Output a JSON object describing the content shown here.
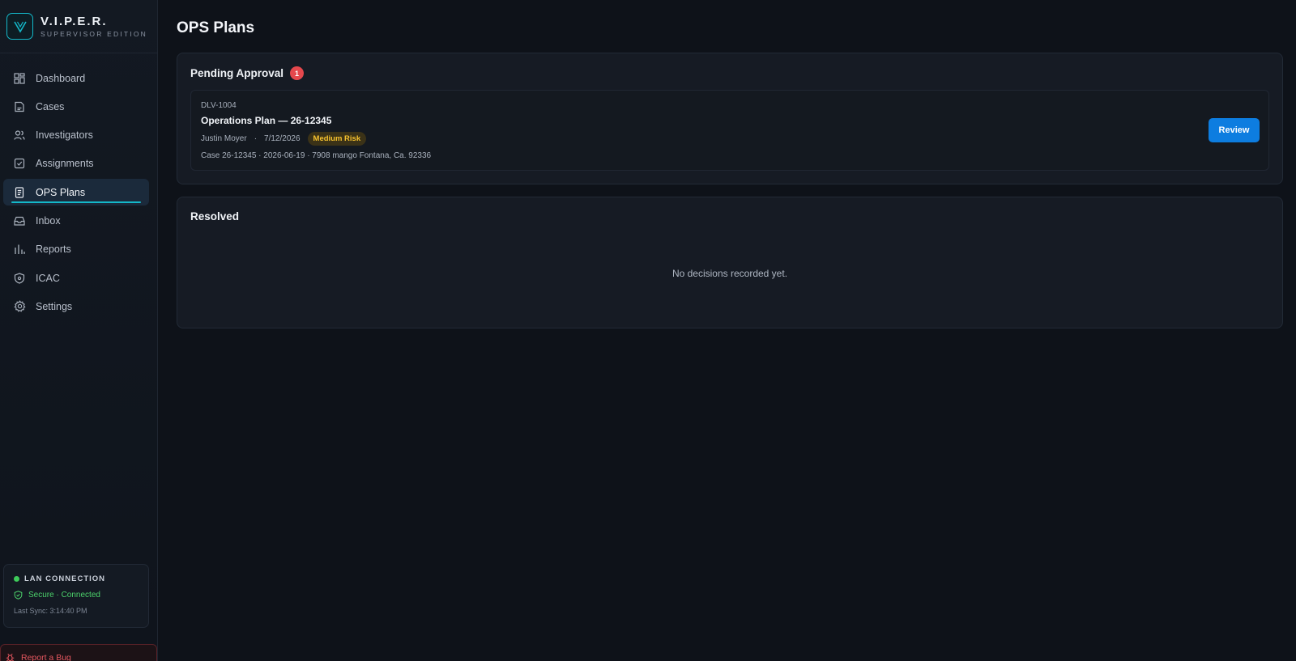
{
  "brand": {
    "title": "V.I.P.E.R.",
    "subtitle": "SUPERVISOR EDITION"
  },
  "sidebar": {
    "items": [
      {
        "label": "Dashboard",
        "icon": "dashboard-icon"
      },
      {
        "label": "Cases",
        "icon": "folder-icon"
      },
      {
        "label": "Investigators",
        "icon": "users-icon"
      },
      {
        "label": "Assignments",
        "icon": "checkbox-icon"
      },
      {
        "label": "OPS Plans",
        "icon": "document-icon",
        "active": true
      },
      {
        "label": "Inbox",
        "icon": "inbox-icon"
      },
      {
        "label": "Reports",
        "icon": "bar-chart-icon"
      },
      {
        "label": "ICAC",
        "icon": "shield-icon"
      },
      {
        "label": "Settings",
        "icon": "gear-icon"
      }
    ]
  },
  "lan": {
    "heading": "LAN CONNECTION",
    "status": "Secure · Connected",
    "last_sync": "Last Sync: 3:14:40 PM"
  },
  "bug_report": {
    "label": "Report a Bug"
  },
  "main": {
    "title": "OPS Plans",
    "pending": {
      "heading": "Pending Approval",
      "count": "1",
      "plans": [
        {
          "id": "DLV-1004",
          "title": "Operations Plan — 26-12345",
          "author": "Justin Moyer",
          "separator": "·",
          "date": "7/12/2026",
          "risk": "Medium Risk",
          "detail": "Case 26-12345 · 2026-06-19 · 7908 mango Fontana, Ca. 92336",
          "action": "Review"
        }
      ]
    },
    "resolved": {
      "heading": "Resolved",
      "empty_text": "No decisions recorded yet."
    }
  },
  "colors": {
    "accent": "#14b8c9",
    "primary_button": "#0d7de0",
    "badge_red": "#e5484d",
    "risk_medium": "#f5c12e",
    "connected_green": "#4cd26b"
  }
}
